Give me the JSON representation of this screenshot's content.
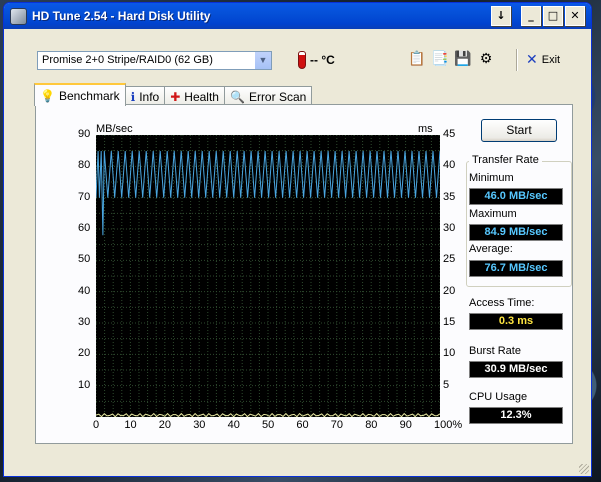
{
  "window": {
    "title": "HD Tune 2.54 - Hard Disk Utility"
  },
  "titlebar_buttons": {
    "help": "↓",
    "minimize": "_",
    "maximize": "□",
    "close": "✕"
  },
  "toolbar": {
    "drive": "Promise 2+0 Stripe/RAID0 (62 GB)",
    "temperature": "-- °C",
    "icons": [
      "copy-text-icon",
      "copy-screenshot-icon",
      "save-icon",
      "options-icon"
    ],
    "exit_label": "Exit"
  },
  "tabs": [
    {
      "label": "Benchmark",
      "icon": "bulb-icon",
      "active": true
    },
    {
      "label": "Info",
      "icon": "info-icon",
      "active": false
    },
    {
      "label": "Health",
      "icon": "health-cross-icon",
      "active": false
    },
    {
      "label": "Error Scan",
      "icon": "magnifier-icon",
      "active": false
    }
  ],
  "start_label": "Start",
  "transfer_rate": {
    "title": "Transfer Rate",
    "minimum_label": "Minimum",
    "minimum_value": "46.0 MB/sec",
    "maximum_label": "Maximum",
    "maximum_value": "84.9 MB/sec",
    "average_label": "Average:",
    "average_value": "76.7 MB/sec"
  },
  "access_time": {
    "label": "Access Time:",
    "value": "0.3 ms"
  },
  "burst_rate": {
    "label": "Burst Rate",
    "value": "30.9 MB/sec"
  },
  "cpu_usage": {
    "label": "CPU Usage",
    "value": "12.3%"
  },
  "chart_data": {
    "type": "line",
    "ylabel_left": "MB/sec",
    "ylabel_right": "ms",
    "x_ticks": [
      "0",
      "10",
      "20",
      "30",
      "40",
      "50",
      "60",
      "70",
      "80",
      "90",
      "100%"
    ],
    "y_left_ticks": [
      "90",
      "80",
      "70",
      "60",
      "50",
      "40",
      "30",
      "20",
      "10"
    ],
    "y_right_ticks": [
      "45",
      "40",
      "35",
      "30",
      "25",
      "20",
      "15",
      "10",
      "5"
    ],
    "xlim": [
      0,
      100
    ],
    "ylim_left": [
      0,
      90
    ],
    "ylim_right": [
      0,
      45
    ],
    "grid": true,
    "colors": {
      "background": "#000000",
      "grid": "#2e4a2e",
      "transfer": "#4aa6e0",
      "access": "#e6e6a0"
    },
    "series": [
      {
        "axis": "left",
        "min": 70,
        "max": 84.9,
        "cycles": 48,
        "start_dip": 58,
        "average": 76.7
      },
      {
        "axis": "right",
        "value": 0.3
      }
    ]
  }
}
